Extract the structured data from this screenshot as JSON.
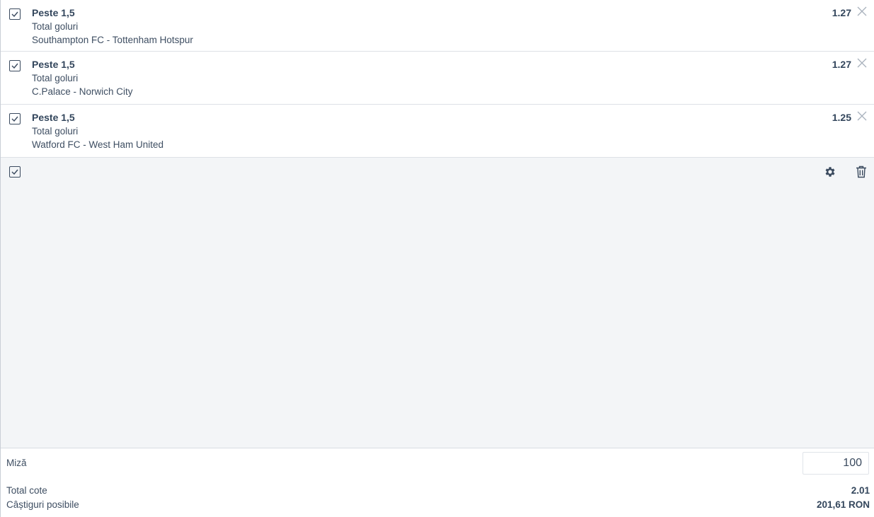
{
  "bets": [
    {
      "selection": "Peste 1,5",
      "market": "Total goluri",
      "match": "Southampton FC - Tottenham Hotspur",
      "odd": "1.27",
      "checked": true
    },
    {
      "selection": "Peste 1,5",
      "market": "Total goluri",
      "match": "C.Palace - Norwich City",
      "odd": "1.27",
      "checked": true
    },
    {
      "selection": "Peste 1,5",
      "market": "Total goluri",
      "match": "Watford FC - West Ham United",
      "odd": "1.25",
      "checked": true
    }
  ],
  "icons": {
    "checkbox": "checkbox-checked-icon",
    "close": "close-icon",
    "settings": "gear-icon",
    "delete": "trash-icon"
  },
  "footer": {
    "stake_label": "Miză",
    "stake_value": "100",
    "total_odds_label": "Total cote",
    "total_odds_value": "2.01",
    "possible_win_label": "Câștiguri posibile",
    "possible_win_value": "201,61 RON"
  },
  "colors": {
    "text": "#3a4a5e",
    "panel_bg": "#f3f5f7",
    "divider": "#dde1e6"
  }
}
